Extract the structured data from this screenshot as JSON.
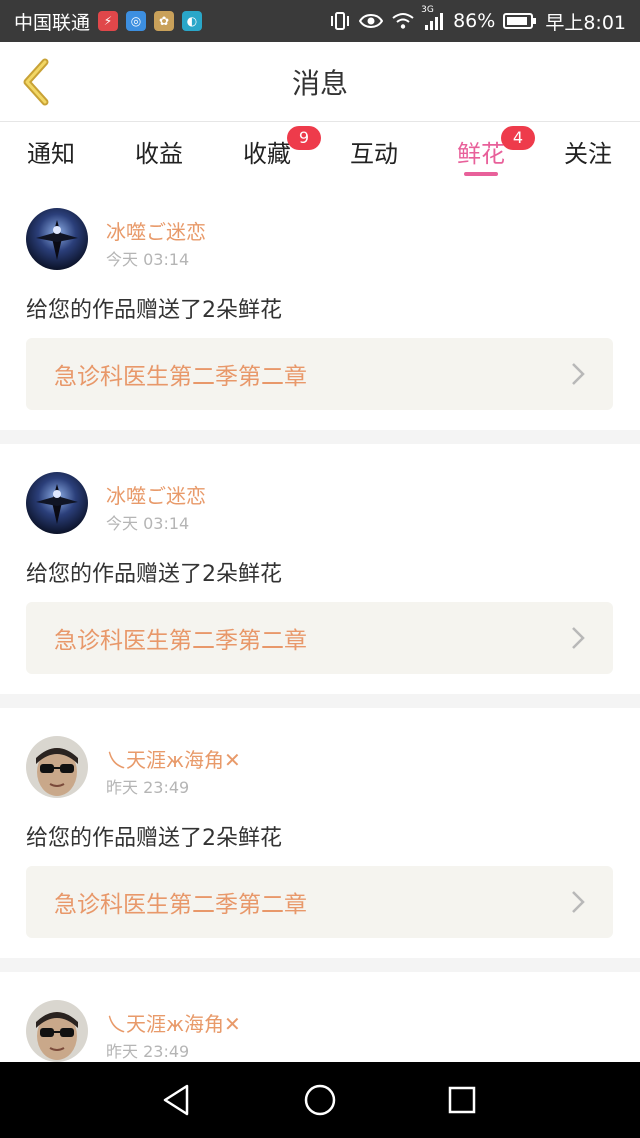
{
  "status_bar": {
    "carrier": "中国联通",
    "battery": "86%",
    "network": "3G",
    "time": "早上8:01",
    "app_icons": [
      "power-app-icon",
      "browser-app-icon",
      "huawei-app-icon",
      "store-app-icon"
    ]
  },
  "header": {
    "title": "消息"
  },
  "tabs": [
    {
      "label": "通知",
      "badge": ""
    },
    {
      "label": "收益",
      "badge": ""
    },
    {
      "label": "收藏",
      "badge": "9"
    },
    {
      "label": "互动",
      "badge": ""
    },
    {
      "label": "鲜花",
      "badge": "4",
      "active": true
    },
    {
      "label": "关注",
      "badge": ""
    }
  ],
  "messages": [
    {
      "user": "冰噬ご迷恋",
      "time": "今天 03:14",
      "text": "给您的作品赠送了2朵鲜花",
      "work": "急诊科医生第二季第二章"
    },
    {
      "user": "冰噬ご迷恋",
      "time": "今天 03:14",
      "text": "给您的作品赠送了2朵鲜花",
      "work": "急诊科医生第二季第二章"
    },
    {
      "user": "乀天涯ж海角✕",
      "time": "昨天 23:49",
      "text": "给您的作品赠送了2朵鲜花",
      "work": "急诊科医生第二季第二章"
    },
    {
      "user": "乀天涯ж海角✕",
      "time": "昨天 23:49",
      "text": "",
      "work": ""
    }
  ],
  "colors": {
    "accent": "#e8609a",
    "badge": "#ee3b4b",
    "username": "#e89a6a",
    "work_title": "#e8986a"
  }
}
